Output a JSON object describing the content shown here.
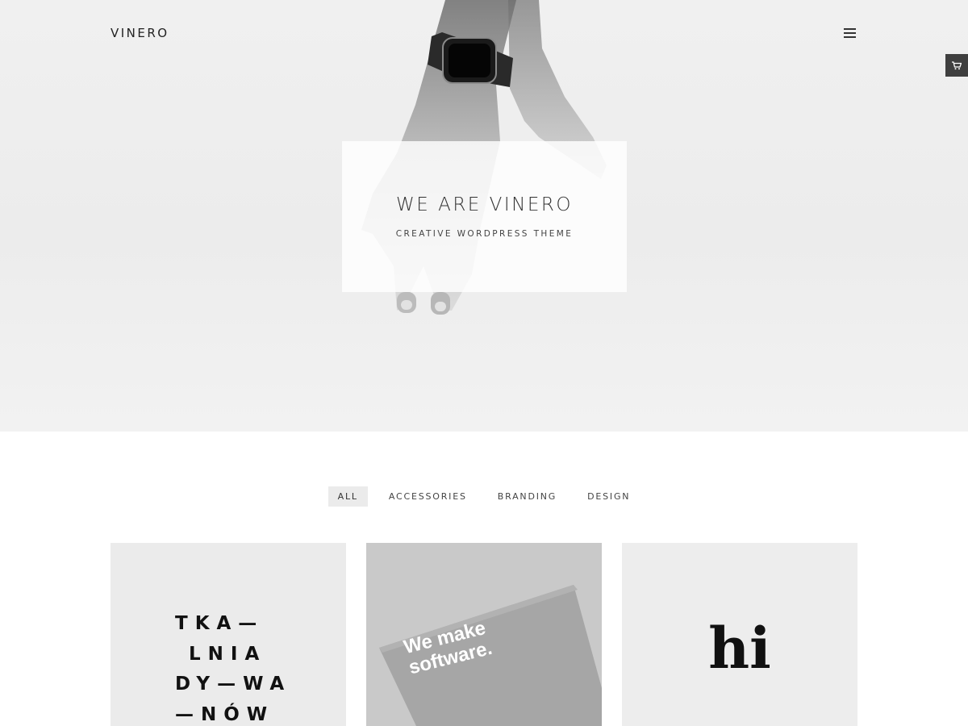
{
  "header": {
    "logo": "VINERO",
    "menu_icon": "hamburger-menu-icon",
    "cart_icon": "cart-icon"
  },
  "hero": {
    "title": "WE ARE VINERO",
    "subtitle": "CREATIVE WORDPRESS THEME"
  },
  "filters": {
    "items": [
      {
        "label": "ALL",
        "active": true
      },
      {
        "label": "ACCESSORIES",
        "active": false
      },
      {
        "label": "BRANDING",
        "active": false
      },
      {
        "label": "DESIGN",
        "active": false
      }
    ]
  },
  "portfolio": {
    "items": [
      {
        "lines": [
          "TKA—",
          " LNIA",
          "DY—WA",
          "—NÓW"
        ]
      },
      {
        "lines": [
          "We make",
          "software."
        ]
      },
      {
        "text": "hi"
      }
    ]
  },
  "colors": {
    "hero_bg": "#ececec",
    "active_filter_bg": "#ebebeb",
    "cart_tab_bg": "#3f3f3f",
    "tile_light": "#ebebeb",
    "tile_grey": "#c9c9c9"
  }
}
